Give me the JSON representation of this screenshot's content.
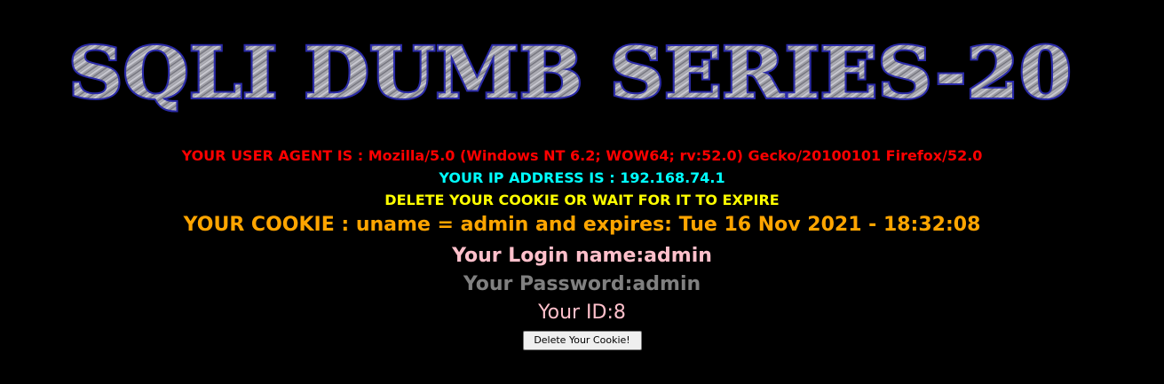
{
  "banner": {
    "title": "SQLI DUMB SERIES-20"
  },
  "info": {
    "user_agent": "YOUR USER AGENT IS : Mozilla/5.0 (Windows NT 6.2; WOW64; rv:52.0) Gecko/20100101 Firefox/52.0",
    "ip_address": "YOUR IP ADDRESS IS : 192.168.74.1",
    "delete_message": "DELETE YOUR COOKIE OR WAIT FOR IT TO EXPIRE",
    "cookie": "YOUR COOKIE : uname = admin and expires: Tue 16 Nov 2021 - 18:32:08",
    "login_name": "Your Login name:admin",
    "password": "Your Password:admin",
    "user_id": "Your ID:8"
  },
  "form": {
    "delete_button_label": "Delete Your Cookie!"
  },
  "colors": {
    "background": "#000000",
    "user_agent": "#ff0000",
    "ip_address": "#00ffff",
    "delete_message": "#ffff00",
    "cookie": "#ffa500",
    "login_name": "#ffc0cb",
    "password": "#808080",
    "user_id": "#ffc0cb",
    "banner_fill": "#a0a0a8",
    "banner_outline": "#2a2aa8"
  }
}
